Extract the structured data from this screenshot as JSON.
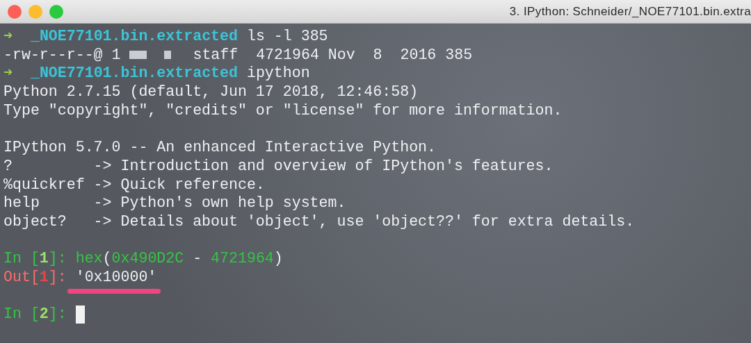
{
  "window": {
    "title": "3. IPython: Schneider/_NOE77101.bin.extra"
  },
  "lines": [
    {
      "kind": "text",
      "segments": [
        {
          "kind": "arrow",
          "text": "➜"
        },
        {
          "kind": "dir",
          "text": "  _NOE77101.bin.extracted"
        },
        {
          "kind": "plain",
          "text": " ls -l 385"
        }
      ]
    },
    {
      "kind": "text",
      "segments": [
        {
          "kind": "plain",
          "text": "-rw-r--r--@ 1 "
        },
        {
          "kind": "redacted"
        },
        {
          "kind": "plain",
          "text": "staff  4721964 Nov  8  2016 385"
        }
      ]
    },
    {
      "kind": "text",
      "segments": [
        {
          "kind": "arrow",
          "text": "➜"
        },
        {
          "kind": "dir",
          "text": "  _NOE77101.bin.extracted"
        },
        {
          "kind": "plain",
          "text": " ipython"
        }
      ]
    },
    {
      "kind": "text",
      "segments": [
        {
          "kind": "plain",
          "text": "Python 2.7.15 (default, Jun 17 2018, 12:46:58)"
        }
      ]
    },
    {
      "kind": "text",
      "segments": [
        {
          "kind": "plain",
          "text": "Type \"copyright\", \"credits\" or \"license\" for more information."
        }
      ]
    },
    {
      "kind": "blank"
    },
    {
      "kind": "text",
      "segments": [
        {
          "kind": "plain",
          "text": "IPython 5.7.0 -- An enhanced Interactive Python."
        }
      ]
    },
    {
      "kind": "text",
      "segments": [
        {
          "kind": "plain",
          "text": "?         -> Introduction and overview of IPython's features."
        }
      ]
    },
    {
      "kind": "text",
      "segments": [
        {
          "kind": "plain",
          "text": "%quickref -> Quick reference."
        }
      ]
    },
    {
      "kind": "text",
      "segments": [
        {
          "kind": "plain",
          "text": "help      -> Python's own help system."
        }
      ]
    },
    {
      "kind": "text",
      "segments": [
        {
          "kind": "plain",
          "text": "object?   -> Details about 'object', use 'object??' for extra details."
        }
      ]
    },
    {
      "kind": "blank"
    },
    {
      "kind": "text",
      "segments": [
        {
          "kind": "in-label",
          "text": "In ["
        },
        {
          "kind": "in-num",
          "text": "1"
        },
        {
          "kind": "in-label",
          "text": "]: hex"
        },
        {
          "kind": "plain",
          "text": "("
        },
        {
          "kind": "in-label",
          "text": "0x490D2C"
        },
        {
          "kind": "plain",
          "text": " - "
        },
        {
          "kind": "in-label",
          "text": "4721964"
        },
        {
          "kind": "plain",
          "text": ")"
        }
      ]
    },
    {
      "kind": "text",
      "segments": [
        {
          "kind": "out-label",
          "text": "Out["
        },
        {
          "kind": "out-num",
          "text": "1"
        },
        {
          "kind": "out-label",
          "text": "]: "
        },
        {
          "kind": "plain",
          "text": "'0x10000'",
          "underlined": true
        }
      ]
    },
    {
      "kind": "blank"
    },
    {
      "kind": "text",
      "segments": [
        {
          "kind": "in-label",
          "text": "In ["
        },
        {
          "kind": "in-num",
          "text": "2"
        },
        {
          "kind": "in-label",
          "text": "]: "
        },
        {
          "kind": "cursor"
        }
      ]
    }
  ]
}
